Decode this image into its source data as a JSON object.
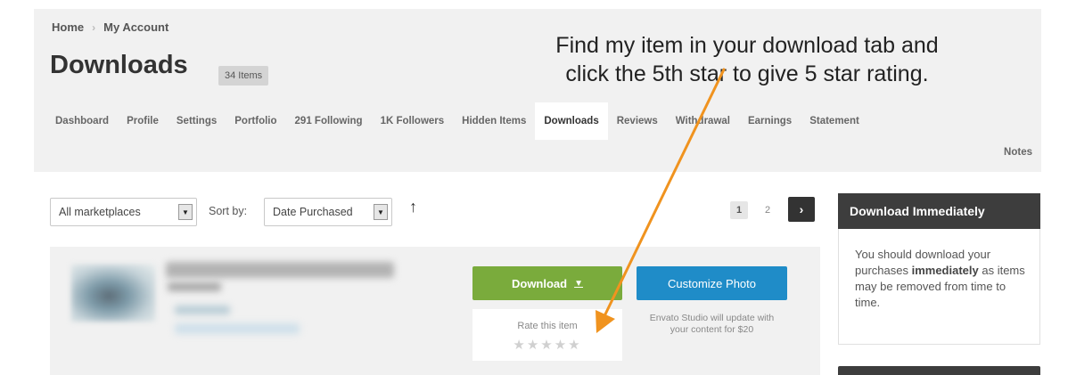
{
  "breadcrumb": {
    "home": "Home",
    "separator": "›",
    "current": "My Account"
  },
  "page": {
    "title": "Downloads",
    "item_count": "34 Items"
  },
  "annotation": {
    "line1": "Find my item in your download tab and",
    "line2": "click the 5th star to give 5 star rating.",
    "arrow_color": "#f0931f"
  },
  "tabs": [
    {
      "label": "Dashboard",
      "active": false
    },
    {
      "label": "Profile",
      "active": false
    },
    {
      "label": "Settings",
      "active": false
    },
    {
      "label": "Portfolio",
      "active": false
    },
    {
      "label": "291 Following",
      "active": false
    },
    {
      "label": "1K Followers",
      "active": false
    },
    {
      "label": "Hidden Items",
      "active": false
    },
    {
      "label": "Downloads",
      "active": true
    },
    {
      "label": "Reviews",
      "active": false
    },
    {
      "label": "Withdrawal",
      "active": false
    },
    {
      "label": "Earnings",
      "active": false
    },
    {
      "label": "Statement",
      "active": false
    },
    {
      "label": "Notes",
      "active": false
    }
  ],
  "toolbar": {
    "marketplace_select": "All marketplaces",
    "sort_label": "Sort by:",
    "sort_select": "Date Purchased",
    "sort_direction_icon": "arrow-up-icon"
  },
  "pagination": {
    "pages": [
      "1",
      "2"
    ],
    "current": "1",
    "next_icon": "chevron-right-icon"
  },
  "download_item": {
    "download_button": "Download",
    "download_caret": "▼",
    "customize_button": "Customize Photo",
    "rate_label": "Rate this item",
    "stars": "★★★★★",
    "star_count": 5,
    "customize_note": "Envato Studio will update with your content for $20"
  },
  "sidebar": {
    "title": "Download Immediately",
    "text_before": "You should download your purchases ",
    "text_bold": "immediately",
    "text_after": " as items may be removed from time to time."
  },
  "colors": {
    "header_bg": "#f1f1f1",
    "download_green": "#7aab3c",
    "customize_blue": "#1f8cc8",
    "panel_dark": "#3d3d3d",
    "arrow_orange": "#f0931f"
  }
}
